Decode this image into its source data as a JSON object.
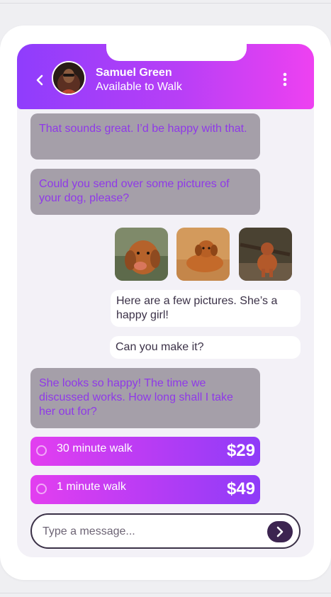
{
  "contact": {
    "name": "Samuel Green",
    "status": "Available to Walk"
  },
  "messages": [
    {
      "from": "them",
      "text": "That sounds great. I’d be happy with that."
    },
    {
      "from": "them",
      "text": "Could you send over some pictures of your dog, please?"
    },
    {
      "from": "me",
      "text": "Here are a few pictures. She’s a happy girl!"
    },
    {
      "from": "me",
      "text": "Can you make it?"
    },
    {
      "from": "them",
      "text": "She looks so happy! The time we discussed works. How long shall I take her out for?"
    }
  ],
  "photos": [
    {
      "name": "dog-photo-1"
    },
    {
      "name": "dog-photo-2"
    },
    {
      "name": "dog-photo-3"
    }
  ],
  "options": [
    {
      "label": "30 minute walk",
      "price": "$29"
    },
    {
      "label": "1 minute walk",
      "price": "$49"
    }
  ],
  "composer": {
    "placeholder": "Type a message..."
  },
  "icons": {
    "back": "chevron-left-icon",
    "menu": "vertical-dots-icon",
    "send": "chevron-right-icon"
  },
  "colors": {
    "accent_start": "#8f3dfc",
    "accent_end": "#ee41f1",
    "incoming_bubble": "#a59fa9",
    "incoming_text": "#8f39e8",
    "send_button": "#3c2450"
  }
}
